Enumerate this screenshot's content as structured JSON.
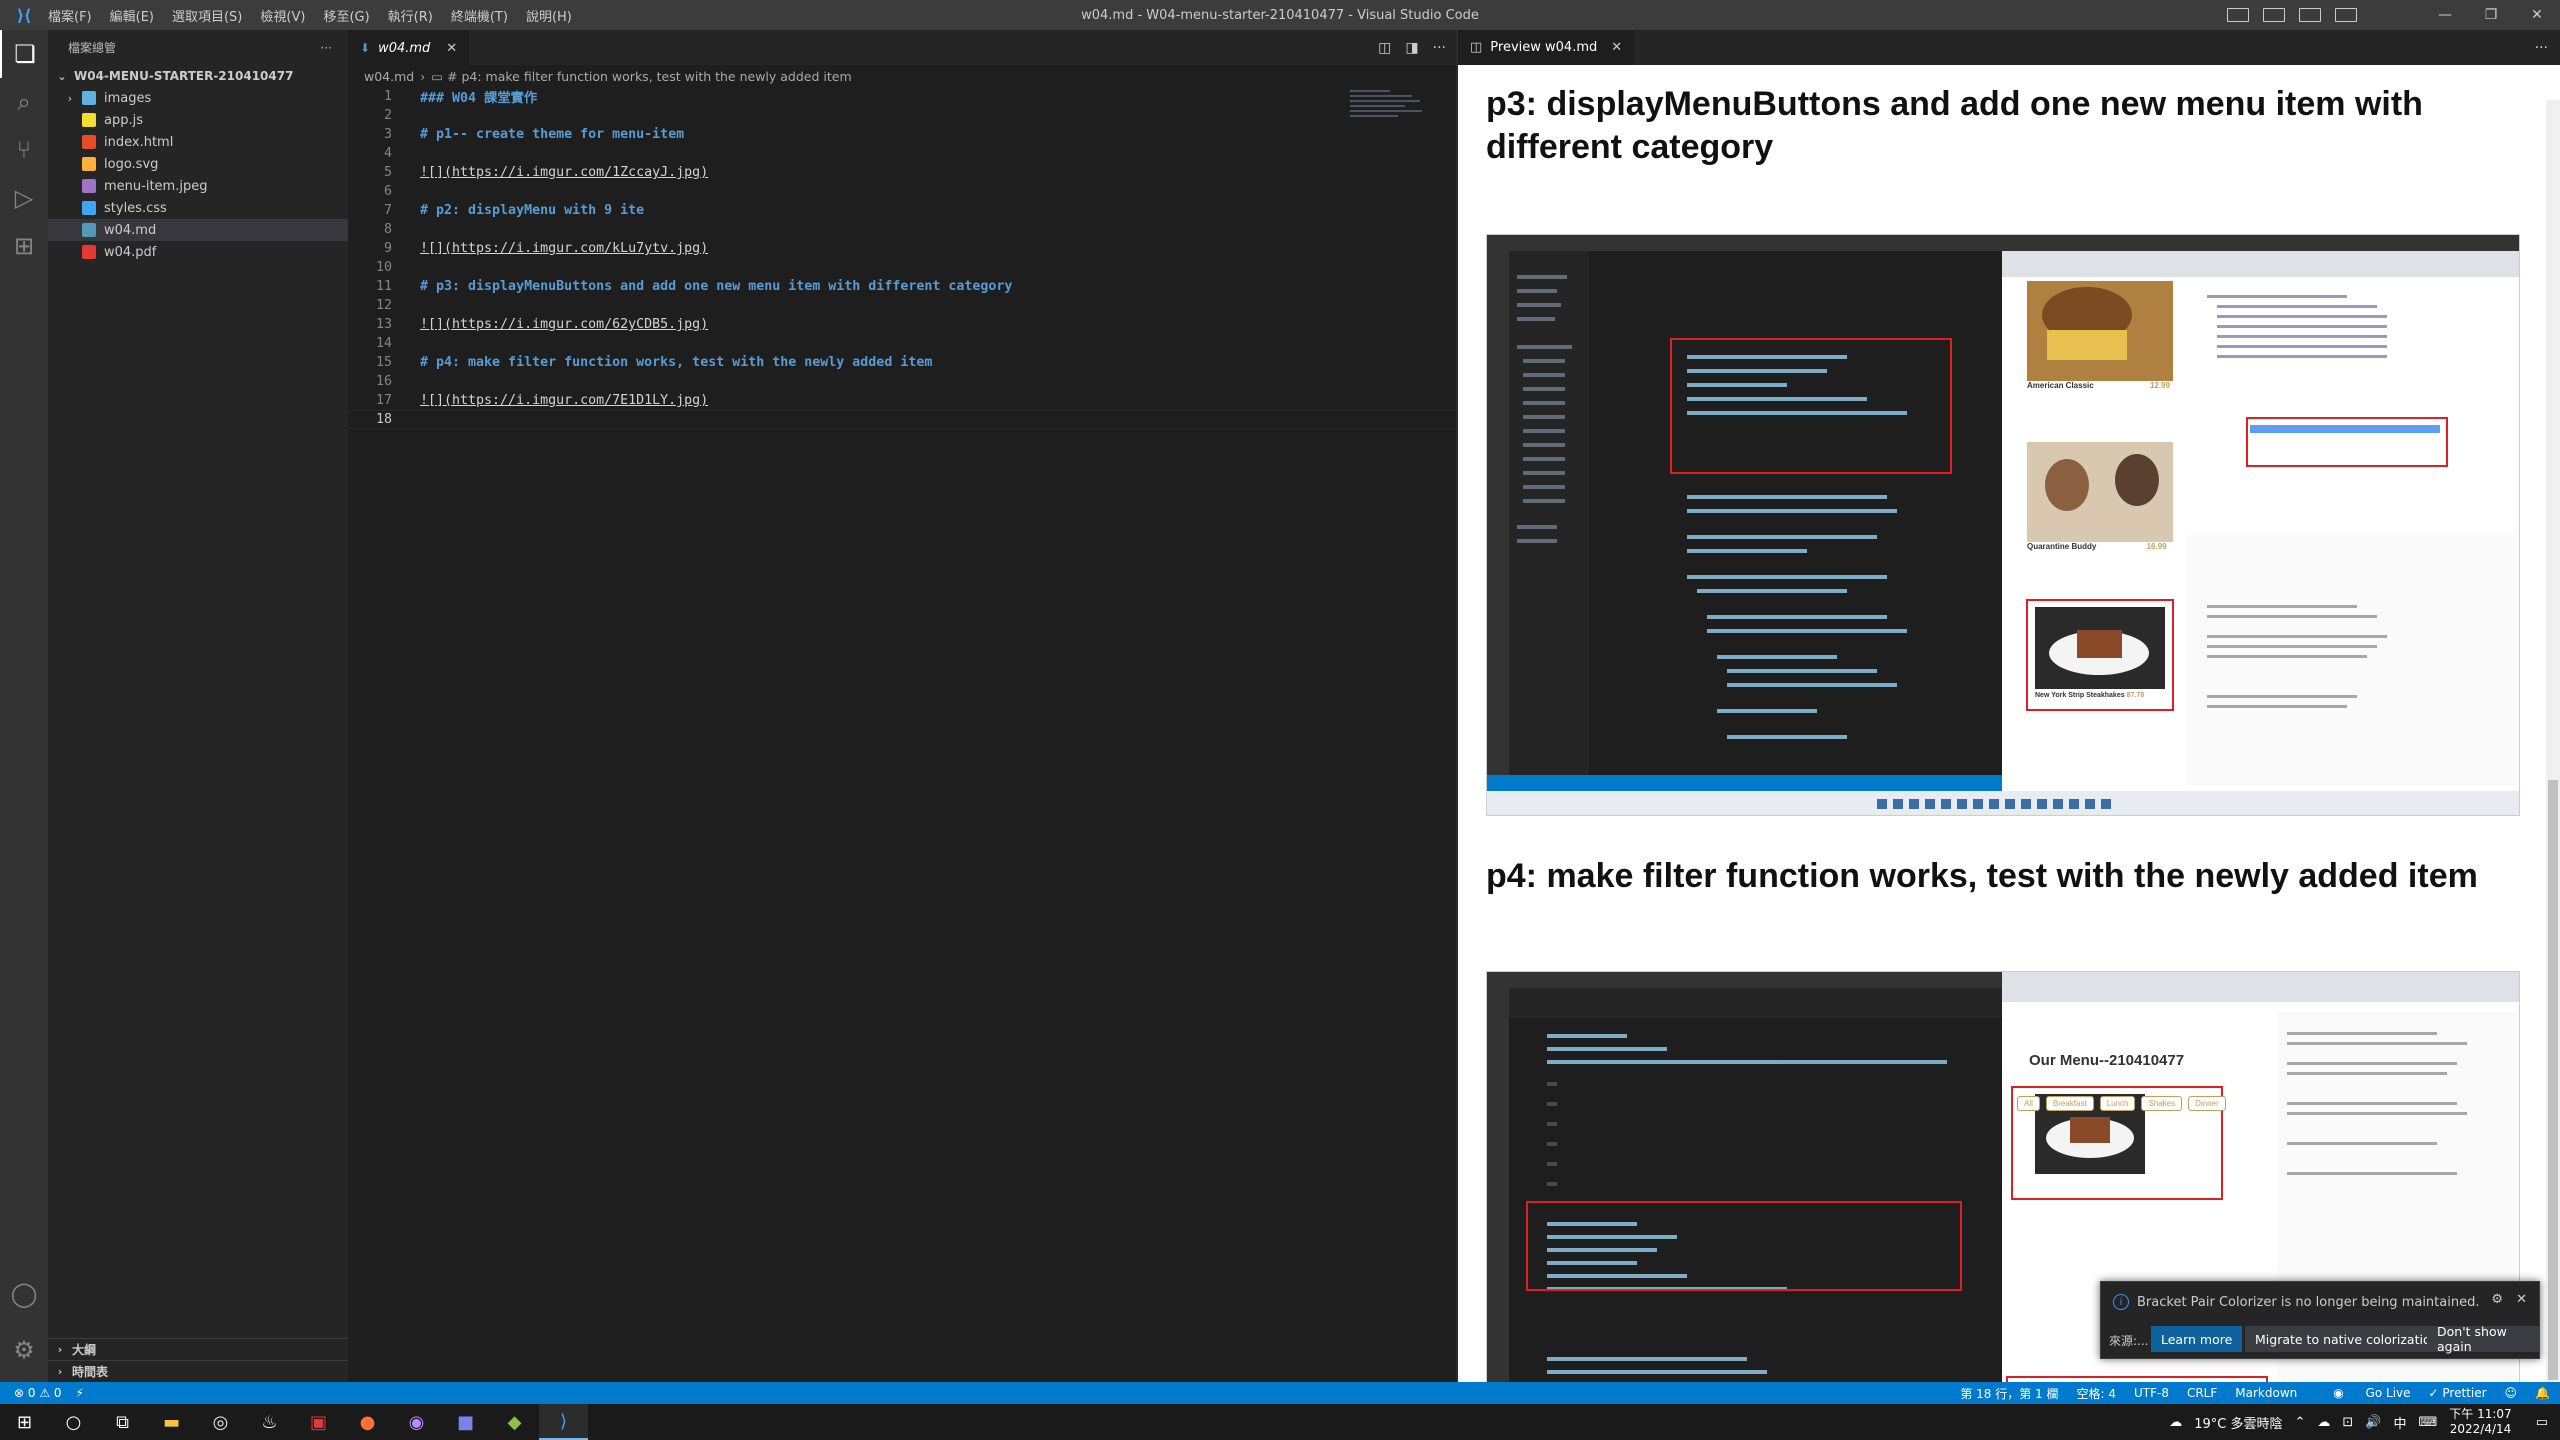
{
  "titlebar": {
    "menus": [
      "檔案(F)",
      "編輯(E)",
      "選取項目(S)",
      "檢視(V)",
      "移至(G)",
      "執行(R)",
      "終端機(T)",
      "說明(H)"
    ],
    "window_title": "w04.md - W04-menu-starter-210410477 - Visual Studio Code"
  },
  "sidebar": {
    "header": "檔案總管",
    "root_folder": "W04-MENU-STARTER-210410477",
    "items": [
      {
        "label": "images",
        "type": "folder"
      },
      {
        "label": "app.js",
        "type": "js"
      },
      {
        "label": "index.html",
        "type": "html"
      },
      {
        "label": "logo.svg",
        "type": "svg"
      },
      {
        "label": "menu-item.jpeg",
        "type": "img"
      },
      {
        "label": "styles.css",
        "type": "css"
      },
      {
        "label": "w04.md",
        "type": "md",
        "selected": true
      },
      {
        "label": "w04.pdf",
        "type": "pdf"
      }
    ],
    "outline_label": "大綱",
    "timeline_label": "時間表"
  },
  "editor": {
    "tab_label": "w04.md",
    "breadcrumb_file": "w04.md",
    "breadcrumb_section": "# p4: make filter function works, test with the newly added item",
    "lines": [
      {
        "n": "1",
        "text": "### W04 課堂實作",
        "kind": "heading"
      },
      {
        "n": "2",
        "text": "",
        "kind": "plain"
      },
      {
        "n": "3",
        "text": "# p1-- create theme for menu-item",
        "kind": "heading"
      },
      {
        "n": "4",
        "text": "",
        "kind": "plain"
      },
      {
        "n": "5",
        "text": "![](https://i.imgur.com/1ZccayJ.jpg)",
        "kind": "link"
      },
      {
        "n": "6",
        "text": "",
        "kind": "plain"
      },
      {
        "n": "7",
        "text": "# p2: displayMenu with 9 ite",
        "kind": "heading"
      },
      {
        "n": "8",
        "text": "",
        "kind": "plain"
      },
      {
        "n": "9",
        "text": "![](https://i.imgur.com/kLu7ytv.jpg)",
        "kind": "link"
      },
      {
        "n": "10",
        "text": "",
        "kind": "plain"
      },
      {
        "n": "11",
        "text": "# p3: displayMenuButtons and add one new menu item with different category",
        "kind": "heading"
      },
      {
        "n": "12",
        "text": "",
        "kind": "plain"
      },
      {
        "n": "13",
        "text": "![](https://i.imgur.com/62yCDB5.jpg)",
        "kind": "link"
      },
      {
        "n": "14",
        "text": "",
        "kind": "plain"
      },
      {
        "n": "15",
        "text": "# p4: make filter function works, test with the newly added item",
        "kind": "heading"
      },
      {
        "n": "16",
        "text": "",
        "kind": "plain"
      },
      {
        "n": "17",
        "text": "![](https://i.imgur.com/7E1D1LY.jpg)",
        "kind": "link"
      },
      {
        "n": "18",
        "text": "",
        "kind": "plain"
      }
    ]
  },
  "preview": {
    "tab_label": "Preview w04.md",
    "heading_p3": "p3: displayMenuButtons and add one new menu item with different category",
    "heading_p4": "p4: make filter function works, test with the newly added item",
    "shot1_food1": "American Classic",
    "shot1_food1_price": "12.99",
    "shot1_food2": "Quarantine Buddy",
    "shot1_food2_price": "16.99",
    "shot1_food3": "New York Strip Steakhakes",
    "shot1_food3_price": "87.78",
    "shot2_title": "Our Menu--210410477",
    "shot2_buttons": [
      "All",
      "Breakfast",
      "Lunch",
      "Shakes",
      "Dinner"
    ]
  },
  "toast": {
    "message": "Bracket Pair Colorizer is no longer being maintained.",
    "source": "來源:...",
    "learn_more": "Learn more",
    "migrate": "Migrate to native colorization",
    "dont_show": "Don't show again"
  },
  "statusbar": {
    "errors": "⊗ 0 ⚠ 0",
    "position": "第 18 行，第 1 欄",
    "spaces": "空格: 4",
    "encoding": "UTF-8",
    "eol": "CRLF",
    "language": "Markdown",
    "golive": "Go Live",
    "prettier": "✓ Prettier"
  },
  "taskbar": {
    "weather": "19°C 多雲時陰",
    "time": "下午 11:07",
    "date": "2022/4/14",
    "ime": "中"
  }
}
